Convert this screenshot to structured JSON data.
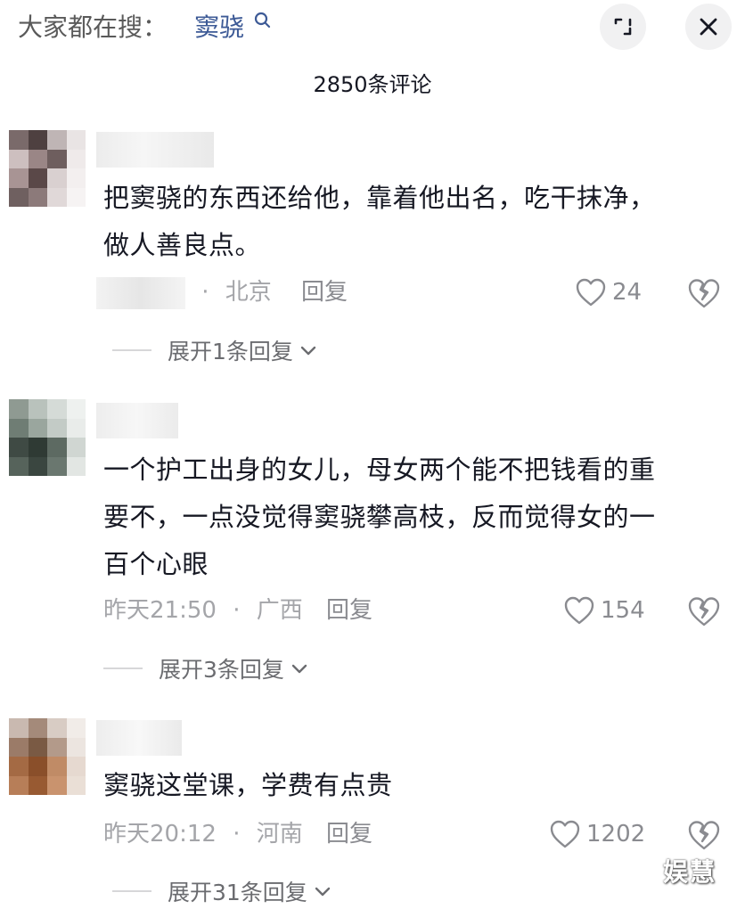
{
  "header": {
    "search_prefix": "大家都在搜：",
    "search_keyword": "窦骁",
    "icons": {
      "search": "search-icon",
      "expand": "expand-icon",
      "close": "close-icon"
    }
  },
  "comment_count": "2850条评论",
  "comments": [
    {
      "text_lines": [
        "把窦骁的东西还给他，靠着他出名，吃干抹净，",
        "做人善良点。"
      ],
      "meta_sep": "·",
      "location": "北京",
      "reply_label": "回复",
      "likes": "24",
      "expand_label": "展开1条回复"
    },
    {
      "text_lines": [
        "一个护工出身的女儿，母女两个能不把钱看的重",
        "要不，一点没觉得窦骁攀高枝，反而觉得女的一",
        "百个心眼"
      ],
      "time": "昨天21:50",
      "meta_sep": "·",
      "location": "广西",
      "reply_label": "回复",
      "likes": "154",
      "expand_label": "展开3条回复"
    },
    {
      "text_lines": [
        "窦骁这堂课，学费有点贵"
      ],
      "time": "昨天20:12",
      "meta_sep": "·",
      "location": "河南",
      "reply_label": "回复",
      "likes": "1202",
      "expand_label": "展开31条回复"
    }
  ],
  "watermark": "娱慧",
  "colors": {
    "keyword": "#3d5a96",
    "meta": "#a4a5a9",
    "text": "#161823",
    "button_bg": "#f1f1f2"
  }
}
